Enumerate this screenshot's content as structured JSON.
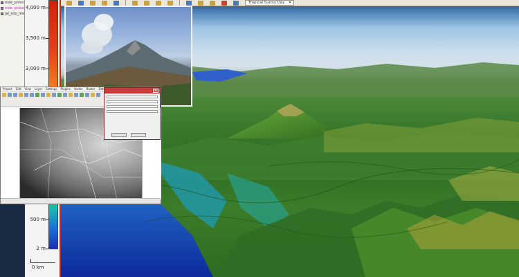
{
  "layers_panel": {
    "items": [
      {
        "label": "mde_princi",
        "color": "#9c59b6",
        "label_style": "normal"
      },
      {
        "label": "mde_global",
        "color": "#c64dc6",
        "label_style": "purple"
      },
      {
        "label": "jal_edo_mex",
        "color": "#5a9a3a",
        "label_style": "normal"
      }
    ]
  },
  "elevation_legend": {
    "ticks": [
      "4,000 m",
      "3,500 m",
      "3,000 m",
      "500 m",
      "2 m"
    ],
    "scale_label": "0 km",
    "colors": {
      "high": "#d41f10",
      "mid": "#eee030",
      "low": "#1a2fb0"
    }
  },
  "viewer_toolbar": {
    "sky_preset": "Tropical Sunny Day",
    "accent_color": "#c9a23a"
  },
  "gis_window": {
    "menus": [
      "Project",
      "Edit",
      "View",
      "Layer",
      "Settings",
      "Plugins",
      "Vector",
      "Raster",
      "Database",
      "Web",
      "Processing",
      "Help"
    ]
  },
  "dialog": {
    "title_color": "#c93c3c"
  },
  "terrain": {
    "colors": {
      "peak": "#3a6b2a",
      "valley": "#1d55c0",
      "water": "#0e2f9e"
    }
  }
}
